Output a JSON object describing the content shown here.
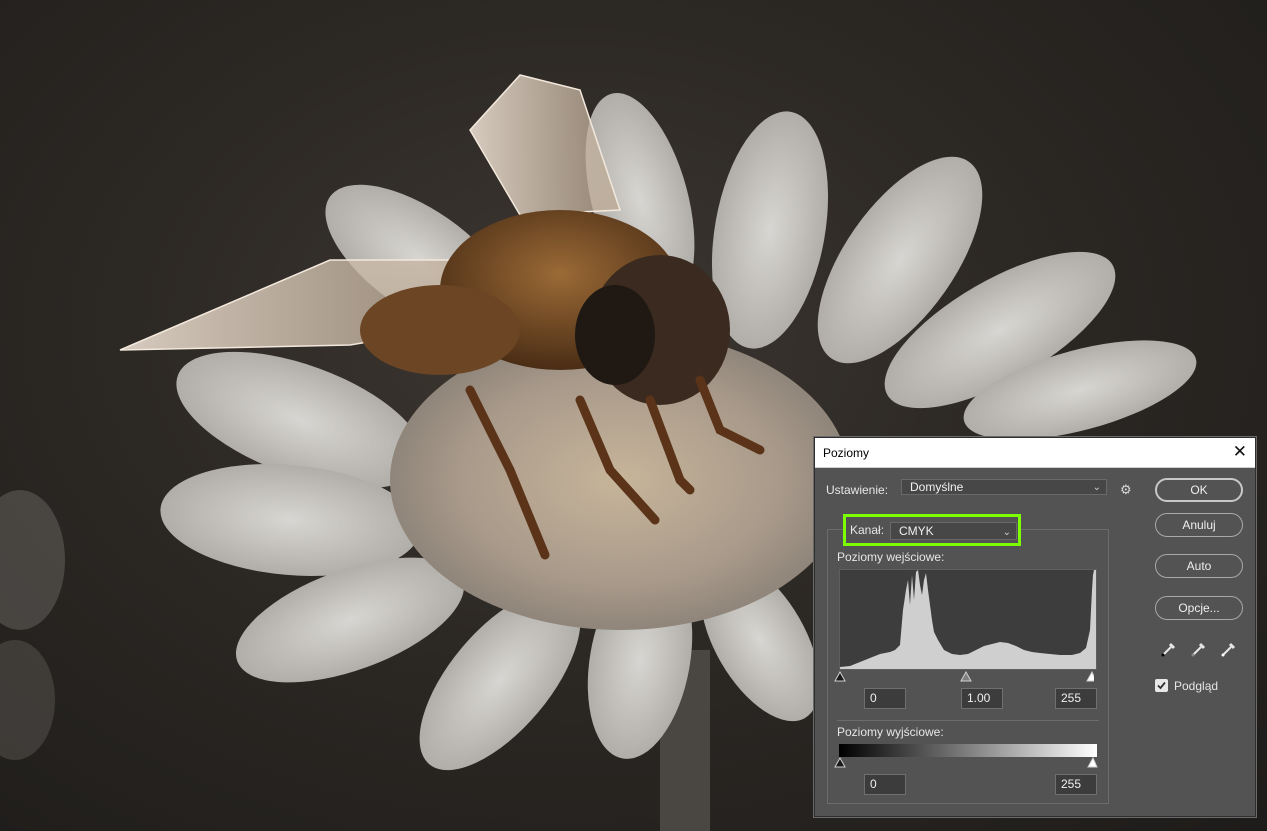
{
  "dialog": {
    "title": "Poziomy",
    "close_glyph": "✕",
    "preset": {
      "label": "Ustawienie:",
      "value": "Domyślne"
    },
    "gear_glyph": "⚙",
    "channel": {
      "label": "Kanał:",
      "value": "CMYK",
      "highlight_color": "#7cff00"
    },
    "input_levels": {
      "label": "Poziomy wejściowe:",
      "black": "0",
      "gamma": "1.00",
      "white": "255"
    },
    "output_levels": {
      "label": "Poziomy wyjściowe:",
      "black": "0",
      "white": "255"
    },
    "buttons": {
      "ok": "OK",
      "cancel": "Anuluj",
      "auto": "Auto",
      "options": "Opcje..."
    },
    "preview": {
      "label": "Podgląd",
      "checked": true
    },
    "eyedroppers": [
      "black-point-eyedropper-icon",
      "gray-point-eyedropper-icon",
      "white-point-eyedropper-icon"
    ]
  }
}
